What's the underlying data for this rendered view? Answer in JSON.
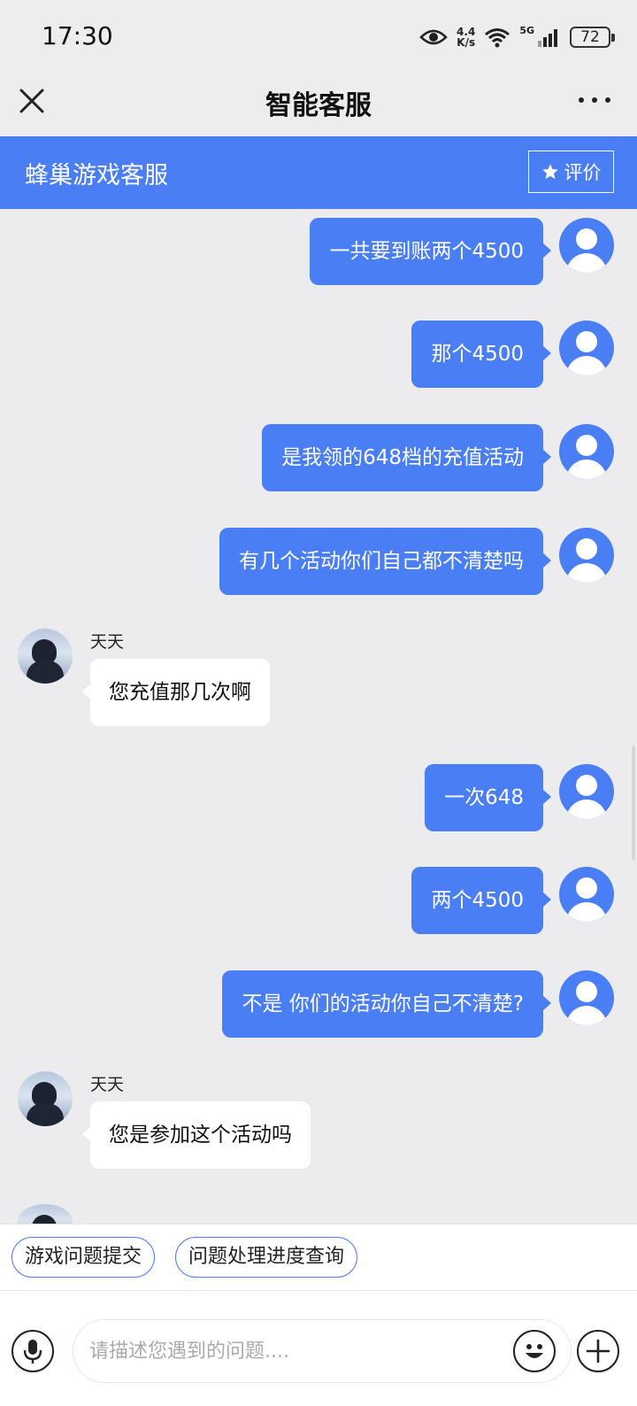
{
  "status_bar": {
    "time": "17:30",
    "speed_value": "4.4",
    "speed_unit": "K/s",
    "network": "5G",
    "battery": "72"
  },
  "header": {
    "title": "智能客服"
  },
  "service_bar": {
    "title": "蜂巢游戏客服",
    "rate_label": "评价"
  },
  "messages": [
    {
      "side": "self",
      "text": "一共要到账两个4500"
    },
    {
      "side": "self",
      "text": "那个4500"
    },
    {
      "side": "self",
      "text": "是我领的648档的充值活动"
    },
    {
      "side": "self",
      "text": "有几个活动你们自己都不清楚吗"
    },
    {
      "side": "other",
      "name": "天天",
      "text": "您充值那几次啊"
    },
    {
      "side": "self",
      "text": "一次648"
    },
    {
      "side": "self",
      "text": "两个4500"
    },
    {
      "side": "self",
      "text": "不是  你们的活动你自己不清楚?"
    },
    {
      "side": "other",
      "name": "天天",
      "text": "您是参加这个活动吗"
    }
  ],
  "quick_replies": [
    "游戏问题提交",
    "问题处理进度查询"
  ],
  "input": {
    "placeholder": "请描述您遇到的问题...."
  },
  "colors": {
    "accent": "#4a7ef4",
    "background": "#ececee"
  }
}
